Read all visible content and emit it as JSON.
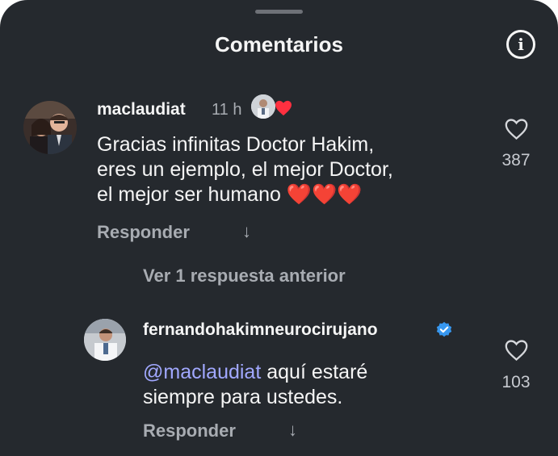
{
  "header": {
    "title": "Comentarios"
  },
  "comments": [
    {
      "username": "maclaudiat",
      "time": "11 h",
      "text_lines": [
        "Gracias infinitas Doctor Hakim,",
        "eres un ejemplo, el mejor Doctor,",
        "el mejor ser humano ❤️❤️❤️"
      ],
      "likes": "387",
      "reply_label": "Responder"
    }
  ],
  "replies": {
    "see_previous_label": "Ver 1 respuesta anterior",
    "items": [
      {
        "username": "fernandohakimneurocirujano",
        "mention": "@maclaudiat",
        "text_line1_rest": " aquí estaré",
        "text_line2": "siempre para ustedes.",
        "likes": "103",
        "reply_label": "Responder"
      }
    ]
  },
  "icons": {
    "info": "info-icon",
    "heart": "heart-outline-icon",
    "arrow": "arrow-down-icon",
    "verified": "verified-badge-icon",
    "liked_by_creator": "heart-filled-icon"
  },
  "colors": {
    "background": "#25292e",
    "text": "#f5f5f5",
    "muted": "#a8acb2",
    "mention": "#a1a8ff",
    "verified": "#3797f0",
    "heart": "#ff3040"
  }
}
